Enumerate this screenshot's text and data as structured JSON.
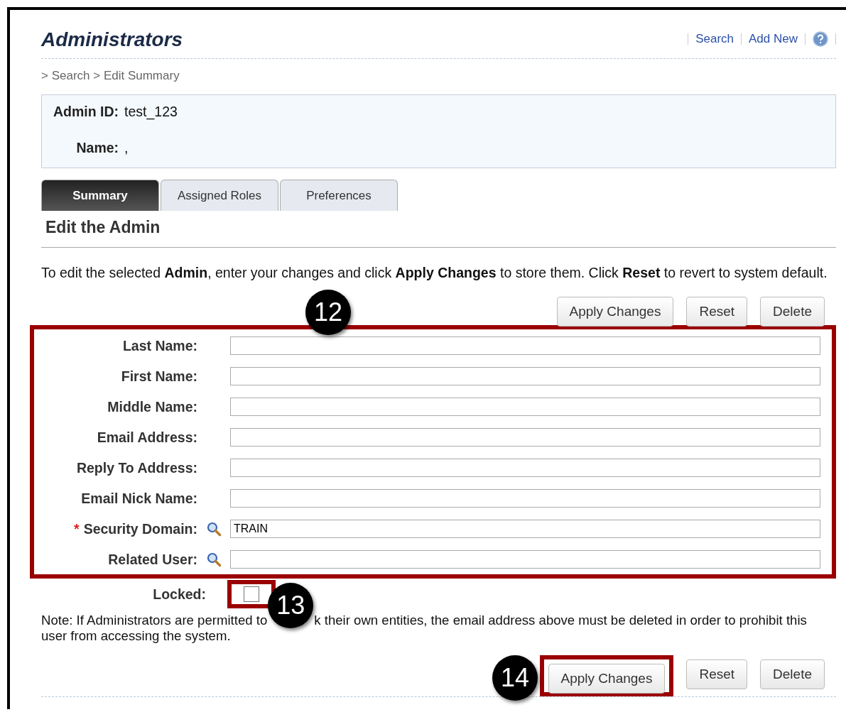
{
  "header": {
    "title": "Administrators",
    "links": [
      "Search",
      "Add New"
    ]
  },
  "breadcrumb": "> Search > Edit Summary",
  "summary": [
    {
      "label": "Admin ID:",
      "value": "test_123"
    },
    {
      "label": "Name:",
      "value": ","
    }
  ],
  "tabs": [
    {
      "label": "Summary",
      "selected": true
    },
    {
      "label": "Assigned Roles",
      "selected": false
    },
    {
      "label": "Preferences",
      "selected": false
    }
  ],
  "section_title": "Edit the Admin",
  "instructions": "To edit the selected **Admin**, enter your changes and click **Apply Changes** to store them. Click **Reset** to revert to system default.",
  "buttons": [
    "Apply Changes",
    "Reset",
    "Delete"
  ],
  "required_marker": "*",
  "fields": [
    {
      "label": "Last Name:",
      "required": false,
      "lookup": false
    },
    {
      "label": "First Name:",
      "required": false,
      "lookup": false
    },
    {
      "label": "Middle Name:",
      "required": false,
      "lookup": false
    },
    {
      "label": "Email Address:",
      "required": false,
      "lookup": false
    },
    {
      "label": "Reply To Address:",
      "required": false,
      "lookup": false
    },
    {
      "label": "Email Nick Name:",
      "required": false,
      "lookup": false
    },
    {
      "label": "Security Domain:",
      "value": "TRAIN",
      "required": true,
      "lookup": true
    },
    {
      "label": "Related User:",
      "required": false,
      "lookup": true
    }
  ],
  "locked": {
    "label": "Locked:",
    "checked": false
  },
  "note": [
    "Note: If Administrators are permitted to",
    "k their own entities, the email address above must be deleted in order to prohibit this",
    "user from accessing the system."
  ],
  "bottom_buttons": [
    "Apply Changes",
    "Reset",
    "Delete"
  ],
  "callouts": [
    "12",
    "13",
    "14"
  ]
}
